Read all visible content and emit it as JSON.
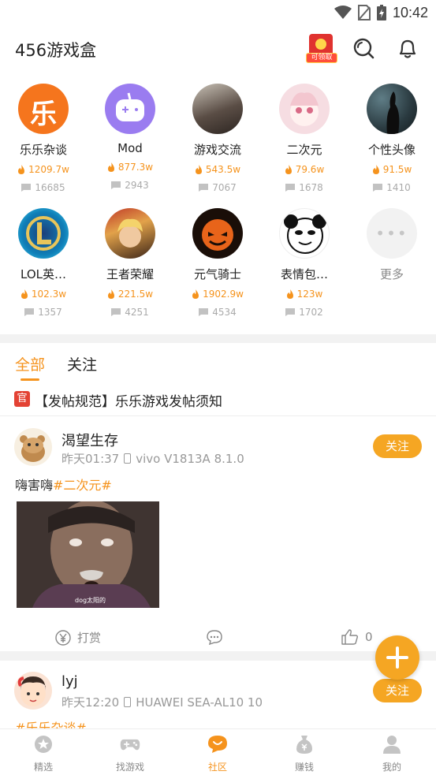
{
  "status_bar": {
    "time": "10:42"
  },
  "app": {
    "title": "456游戏盒",
    "redpacket_label": "可领取"
  },
  "boards": [
    {
      "name": "乐乐杂谈",
      "heat": "1209.7w",
      "posts": "16685"
    },
    {
      "name": "Mod",
      "heat": "877.3w",
      "posts": "2943"
    },
    {
      "name": "游戏交流",
      "heat": "543.5w",
      "posts": "7067"
    },
    {
      "name": "二次元",
      "heat": "79.6w",
      "posts": "1678"
    },
    {
      "name": "个性头像",
      "heat": "91.5w",
      "posts": "1410"
    },
    {
      "name": "LOL英…",
      "heat": "102.3w",
      "posts": "1357"
    },
    {
      "name": "王者荣耀",
      "heat": "221.5w",
      "posts": "4251"
    },
    {
      "name": "元气骑士",
      "heat": "1902.9w",
      "posts": "4534"
    },
    {
      "name": "表情包…",
      "heat": "123w",
      "posts": "1702"
    },
    {
      "name": "更多"
    }
  ],
  "feed_tabs": {
    "all": "全部",
    "follow": "关注"
  },
  "notice": {
    "badge": "官",
    "text": "【发帖规范】乐乐游戏发帖须知"
  },
  "posts": [
    {
      "user": "渴望生存",
      "time": "昨天01:37",
      "device": "vivo V1813A 8.1.0",
      "text": "嗨害嗨",
      "topic": "#二次元#",
      "image_caption": "dog太阳的",
      "tip_label": "打赏",
      "like_count": "0",
      "follow_label": "关注"
    },
    {
      "user": "lyj",
      "time": "昨天12:20",
      "device": "HUAWEI SEA-AL10 10",
      "topic": "#乐乐杂谈#",
      "follow_label": "关注"
    }
  ],
  "bottom_nav": [
    {
      "label": "精选"
    },
    {
      "label": "找游戏"
    },
    {
      "label": "社区"
    },
    {
      "label": "赚钱"
    },
    {
      "label": "我的"
    }
  ],
  "colors": {
    "accent": "#f5931d",
    "follow_button": "#f5a623",
    "official_badge": "#e34234"
  }
}
